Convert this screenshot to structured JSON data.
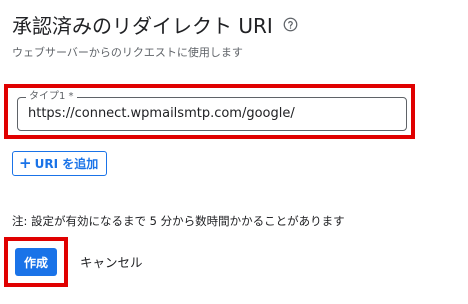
{
  "dialog": {
    "title": "承認済みのリダイレクト URI",
    "subtitle": "ウェブサーバーからのリクエストに使用します",
    "help_icon": "help-circle-icon"
  },
  "uri_field": {
    "label": "タイプ1 *",
    "value": "https://connect.wpmailsmtp.com/google/"
  },
  "add_uri_button": {
    "icon": "plus-icon",
    "icon_glyph": "+",
    "label": "URI を追加"
  },
  "note": "注: 設定が有効になるまで 5 分から数時間かかることがあります",
  "actions": {
    "create_label": "作成",
    "cancel_label": "キャンセル"
  },
  "colors": {
    "accent": "#1a73e8",
    "highlight": "#e00000"
  }
}
